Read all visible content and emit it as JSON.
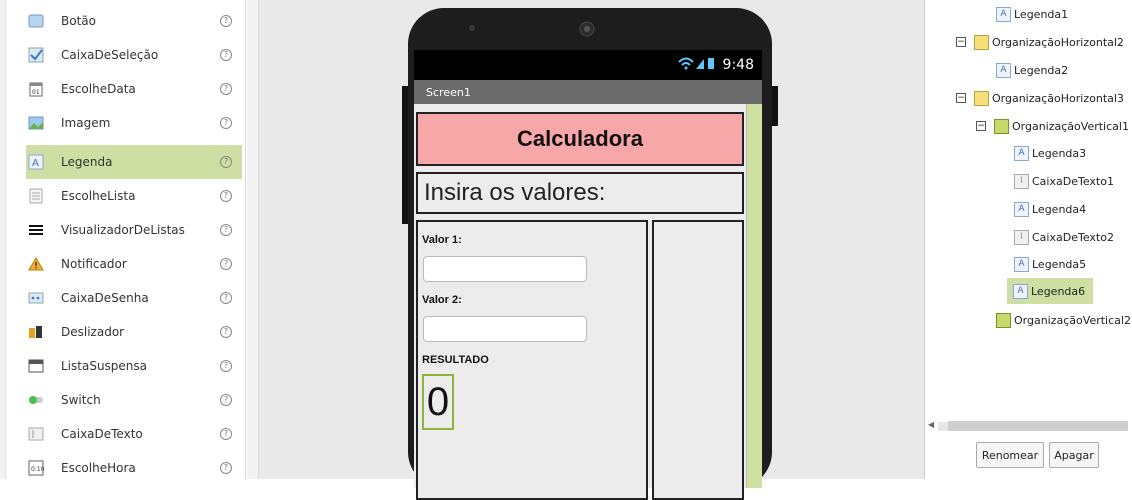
{
  "palette": {
    "items": [
      {
        "label": "Botão",
        "icon": "button-icon"
      },
      {
        "label": "CaixaDeSeleção",
        "icon": "checkbox-icon"
      },
      {
        "label": "EscolheData",
        "icon": "calendar-icon"
      },
      {
        "label": "Imagem",
        "icon": "image-icon"
      },
      {
        "label": "Legenda",
        "icon": "label-icon",
        "selected": true
      },
      {
        "label": "EscolheLista",
        "icon": "listpicker-icon"
      },
      {
        "label": "VisualizadorDeListas",
        "icon": "listview-icon"
      },
      {
        "label": "Notificador",
        "icon": "warning-icon"
      },
      {
        "label": "CaixaDeSenha",
        "icon": "password-icon"
      },
      {
        "label": "Deslizador",
        "icon": "slider-icon"
      },
      {
        "label": "ListaSuspensa",
        "icon": "spinner-icon"
      },
      {
        "label": "Switch",
        "icon": "switch-icon"
      },
      {
        "label": "CaixaDeTexto",
        "icon": "textbox-icon"
      },
      {
        "label": "EscolheHora",
        "icon": "clock-icon"
      }
    ],
    "help_glyph": "?"
  },
  "phone": {
    "time": "9:48",
    "screen_title": "Screen1",
    "app_title": "Calculadora",
    "prompt": "Insira os valores:",
    "label_valor1": "Valor 1:",
    "label_valor2": "Valor 2:",
    "label_resultado": "RESULTADO",
    "result_value": "0",
    "colors": {
      "title_bg": "#f7a7a7",
      "accent": "#cfe0a0",
      "result_border": "#8db33a"
    }
  },
  "tree": {
    "nodes": [
      {
        "label": "Legenda1",
        "type": "legend"
      },
      {
        "label": "OrganizaçãoHorizontal2",
        "type": "horiz",
        "toggle": "⊟"
      },
      {
        "label": "Legenda2",
        "type": "legend"
      },
      {
        "label": "OrganizaçãoHorizontal3",
        "type": "horiz",
        "toggle": "⊟"
      },
      {
        "label": "OrganizaçãoVertical1",
        "type": "vert",
        "toggle": "⊟"
      },
      {
        "label": "Legenda3",
        "type": "legend"
      },
      {
        "label": "CaixaDeTexto1",
        "type": "text"
      },
      {
        "label": "Legenda4",
        "type": "legend"
      },
      {
        "label": "CaixaDeTexto2",
        "type": "text"
      },
      {
        "label": "Legenda5",
        "type": "legend"
      },
      {
        "label": "Legenda6",
        "type": "legend",
        "selected": true
      },
      {
        "label": "OrganizaçãoVertical2",
        "type": "vert"
      }
    ],
    "rename_label": "Renomear",
    "delete_label": "Apagar"
  }
}
